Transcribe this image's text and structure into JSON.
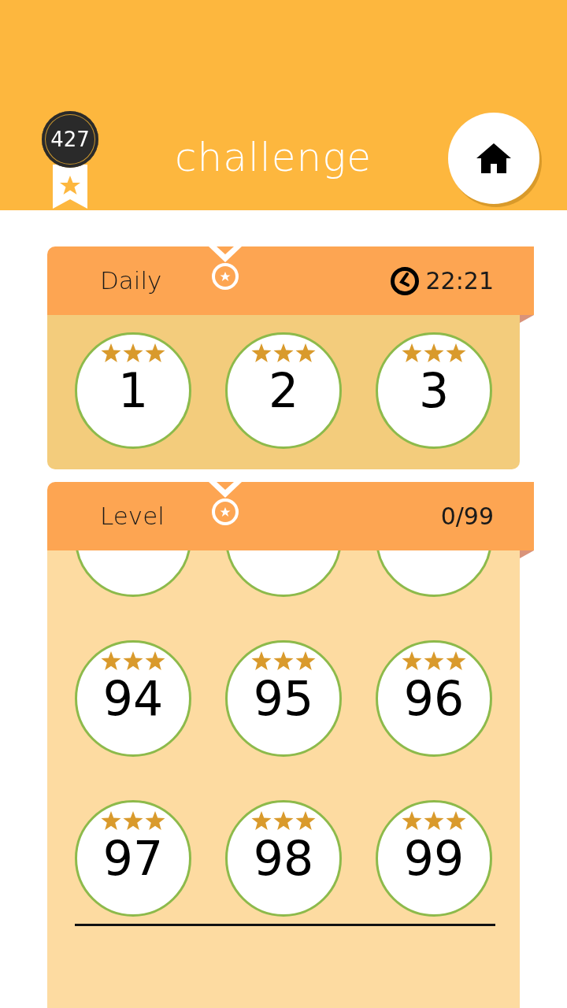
{
  "header": {
    "score": "427",
    "title": "challenge"
  },
  "daily": {
    "title": "Daily",
    "timer": "22:21",
    "levels": [
      {
        "kind": "full",
        "number": "1",
        "stars": 3
      },
      {
        "kind": "full",
        "number": "2",
        "stars": 3
      },
      {
        "kind": "full",
        "number": "3",
        "stars": 3
      }
    ]
  },
  "level_section": {
    "title": "Level",
    "progress": "0/99",
    "levels": [
      {
        "kind": "cut"
      },
      {
        "kind": "cut"
      },
      {
        "kind": "cut"
      },
      {
        "kind": "full",
        "number": "94",
        "stars": 3
      },
      {
        "kind": "full",
        "number": "95",
        "stars": 3
      },
      {
        "kind": "full",
        "number": "96",
        "stars": 3
      },
      {
        "kind": "full",
        "number": "97",
        "stars": 3
      },
      {
        "kind": "full",
        "number": "98",
        "stars": 3
      },
      {
        "kind": "full",
        "number": "99",
        "stars": 3
      }
    ]
  }
}
